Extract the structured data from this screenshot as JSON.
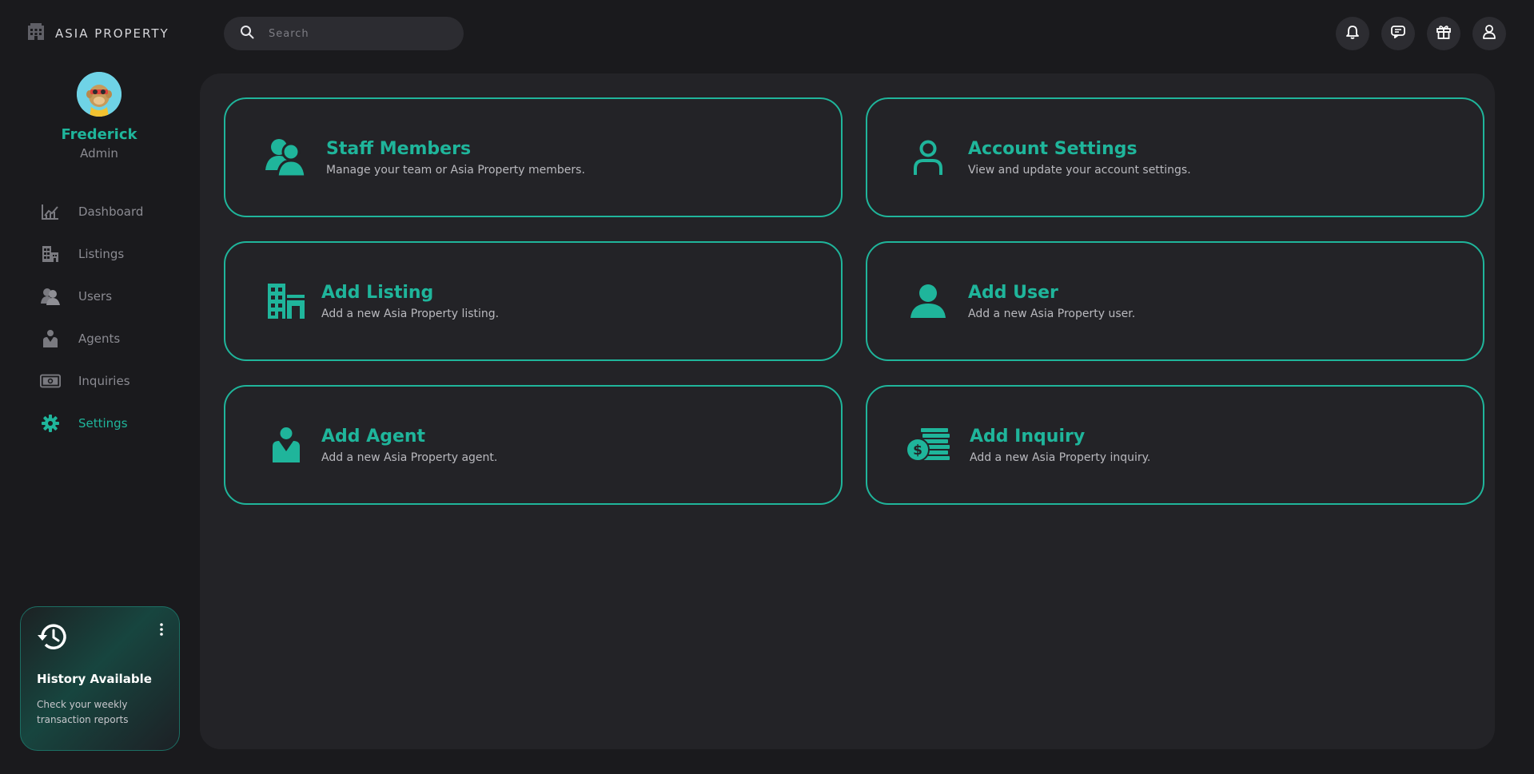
{
  "brand": {
    "name": "ASIA PROPERTY"
  },
  "profile": {
    "name": "Frederick",
    "role": "Admin"
  },
  "nav": {
    "items": [
      {
        "label": "Dashboard",
        "icon": "chart-icon"
      },
      {
        "label": "Listings",
        "icon": "building-icon"
      },
      {
        "label": "Users",
        "icon": "users-icon"
      },
      {
        "label": "Agents",
        "icon": "agent-icon"
      },
      {
        "label": "Inquiries",
        "icon": "money-icon"
      },
      {
        "label": "Settings",
        "icon": "gear-icon",
        "active": true
      }
    ]
  },
  "history_card": {
    "title": "History Available",
    "text": "Check your weekly transaction reports"
  },
  "search": {
    "placeholder": "Search"
  },
  "cards": [
    {
      "title": "Staff Members",
      "desc": "Manage your team or Asia Property members."
    },
    {
      "title": "Account Settings",
      "desc": "View and update your account settings."
    },
    {
      "title": "Add Listing",
      "desc": "Add a new Asia Property listing."
    },
    {
      "title": "Add User",
      "desc": "Add a new Asia Property user."
    },
    {
      "title": "Add Agent",
      "desc": "Add a new Asia Property agent."
    },
    {
      "title": "Add Inquiry",
      "desc": "Add a new Asia Property inquiry."
    }
  ],
  "colors": {
    "accent": "#1fb59b",
    "background": "#1a1a1d",
    "panel": "#232327"
  }
}
